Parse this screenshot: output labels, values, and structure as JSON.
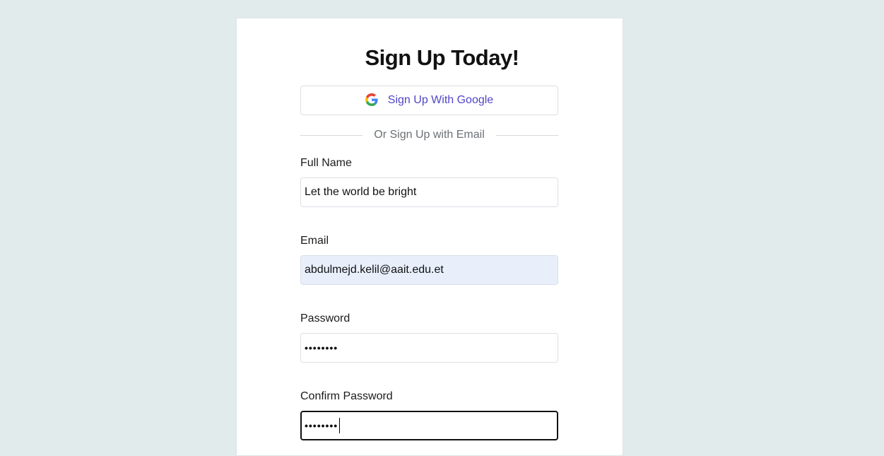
{
  "form": {
    "title": "Sign Up Today!",
    "google_button_label": "Sign Up With Google",
    "divider_text": "Or Sign Up with Email",
    "fields": [
      {
        "label": "Full Name",
        "value": "Let the world be bright"
      },
      {
        "label": "Email",
        "value": "abdulmejd.kelil@aait.edu.et"
      },
      {
        "label": "Password",
        "value": "••••••••"
      },
      {
        "label": "Confirm Password",
        "value": "••••••••"
      }
    ]
  },
  "icons": {
    "google": "google-g-logo-icon"
  },
  "colors": {
    "page_background": "#e2ebec",
    "card_background": "#ffffff",
    "link_accent": "#4f46c8",
    "autofill_background": "#e8effb",
    "focus_border": "#111111"
  }
}
